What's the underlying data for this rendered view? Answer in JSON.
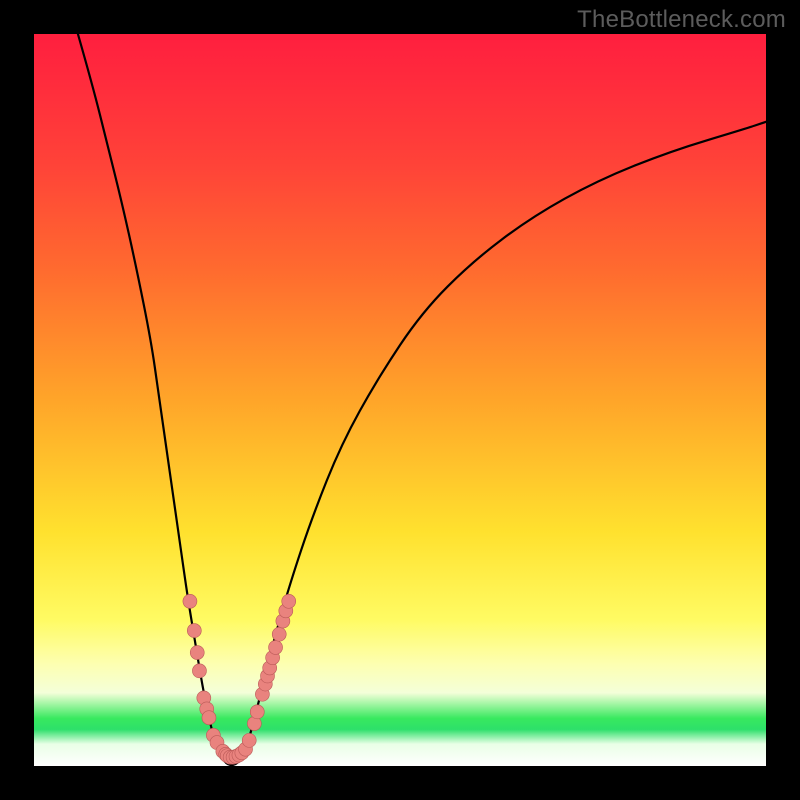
{
  "watermark": "TheBottleneck.com",
  "colors": {
    "curve_stroke": "#000000",
    "marker_fill": "#e9837e",
    "marker_stroke": "#bb5a58",
    "plot_border": "#000000"
  },
  "chart_data": {
    "type": "line",
    "title": "",
    "xlabel": "",
    "ylabel": "",
    "xlim": [
      0,
      100
    ],
    "ylim": [
      0,
      100
    ],
    "grid": false,
    "legend": false,
    "curve": {
      "note": "Bottleneck-style V curve; x normalized 0–100, y = bottleneck percentage 0–100 (0 at bottom / best)",
      "points": [
        [
          6,
          100
        ],
        [
          8,
          93
        ],
        [
          10,
          85
        ],
        [
          12,
          77
        ],
        [
          14,
          68
        ],
        [
          16,
          58
        ],
        [
          17,
          51
        ],
        [
          18,
          44
        ],
        [
          19,
          37
        ],
        [
          20,
          30
        ],
        [
          21,
          23
        ],
        [
          22,
          17
        ],
        [
          23,
          11
        ],
        [
          24,
          6
        ],
        [
          25,
          2.5
        ],
        [
          26,
          0.5
        ],
        [
          27,
          0
        ],
        [
          28,
          0.5
        ],
        [
          29,
          2.5
        ],
        [
          30,
          6
        ],
        [
          31,
          10
        ],
        [
          32,
          14
        ],
        [
          33,
          18
        ],
        [
          35,
          25
        ],
        [
          38,
          34
        ],
        [
          42,
          44
        ],
        [
          47,
          53
        ],
        [
          53,
          62
        ],
        [
          60,
          69
        ],
        [
          68,
          75
        ],
        [
          77,
          80
        ],
        [
          87,
          84
        ],
        [
          97,
          87
        ],
        [
          100,
          88
        ]
      ]
    },
    "markers": {
      "note": "Salmon rounded markers clustered along the lower V; values share same x/y scale as curve",
      "points": [
        [
          21.3,
          22.5
        ],
        [
          21.9,
          18.5
        ],
        [
          22.3,
          15.5
        ],
        [
          22.6,
          13.0
        ],
        [
          23.2,
          9.3
        ],
        [
          23.6,
          7.8
        ],
        [
          23.9,
          6.6
        ],
        [
          24.5,
          4.2
        ],
        [
          25.0,
          3.2
        ],
        [
          25.8,
          2.0
        ],
        [
          26.2,
          1.6
        ],
        [
          26.4,
          1.4
        ],
        [
          26.8,
          1.2
        ],
        [
          27.2,
          1.2
        ],
        [
          27.6,
          1.3
        ],
        [
          28.0,
          1.5
        ],
        [
          28.4,
          1.8
        ],
        [
          28.9,
          2.3
        ],
        [
          29.4,
          3.5
        ],
        [
          30.1,
          5.8
        ],
        [
          30.5,
          7.4
        ],
        [
          31.2,
          9.8
        ],
        [
          31.6,
          11.2
        ],
        [
          31.9,
          12.3
        ],
        [
          32.2,
          13.4
        ],
        [
          32.6,
          14.8
        ],
        [
          33.0,
          16.2
        ],
        [
          33.5,
          18.0
        ],
        [
          34.0,
          19.8
        ],
        [
          34.4,
          21.2
        ],
        [
          34.8,
          22.5
        ]
      ],
      "radius": 7
    }
  }
}
